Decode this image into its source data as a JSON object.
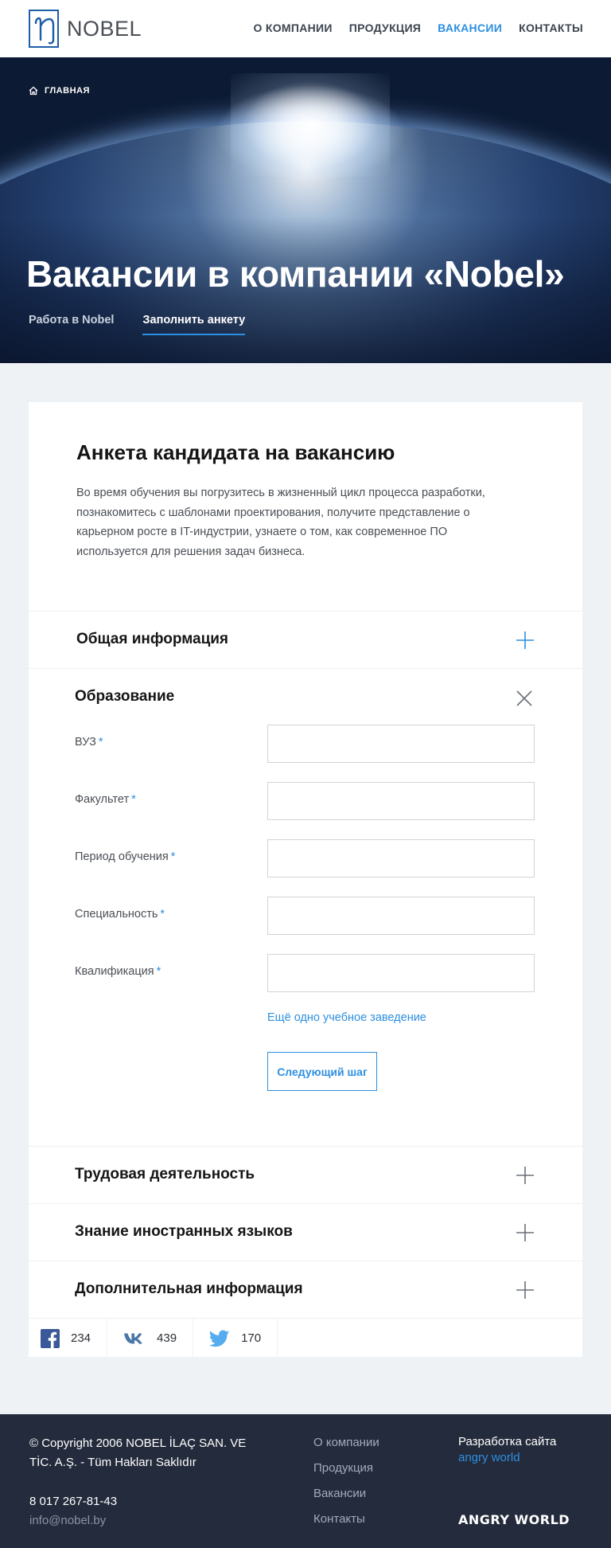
{
  "header": {
    "logo_text": "NOBEL",
    "nav": [
      {
        "label": "О КОМПАНИИ"
      },
      {
        "label": "ПРОДУКЦИЯ"
      },
      {
        "label": "ВАКАНСИИ",
        "active": true
      },
      {
        "label": "КОНТАКТЫ"
      }
    ]
  },
  "hero": {
    "breadcrumb": "ГЛАВНАЯ",
    "title": "Вакансии в компании «Nobel»",
    "tabs": [
      {
        "label": "Работа в Nobel"
      },
      {
        "label": "Заполнить анкету",
        "active": true
      }
    ]
  },
  "form": {
    "title": "Анкета кандидата на вакансию",
    "description": "Во время обучения вы погрузитесь в жизненный цикл процесса разработки, познакомитесь с шаблонами проектирования, получите представление о карьерном росте в IT-индустрии, узнаете о том, как современное ПО используется для решения задач бизнеса.",
    "sections": {
      "general": {
        "title": "Общая информация",
        "icon": "plus-icon"
      },
      "education": {
        "title": "Образование",
        "icon": "close-icon",
        "fields": [
          {
            "label": "ВУЗ",
            "required_mark": "*",
            "value": ""
          },
          {
            "label": "Факультет",
            "required_mark": "*",
            "value": ""
          },
          {
            "label": "Период обучения",
            "required_mark": "*",
            "value": ""
          },
          {
            "label": "Специальность",
            "required_mark": "*",
            "value": ""
          },
          {
            "label": "Квалификация",
            "required_mark": "*",
            "value": ""
          }
        ],
        "add_link": "Ещё одно учебное заведение",
        "next_button": "Следующий шаг"
      },
      "work": {
        "title": "Трудовая деятельность",
        "icon": "plus-icon"
      },
      "languages": {
        "title": "Знание иностранных языков",
        "icon": "plus-icon"
      },
      "additional": {
        "title": "Дополнительная информация",
        "icon": "plus-icon"
      }
    }
  },
  "share": [
    {
      "network": "facebook-icon",
      "count": "234",
      "color": "#3b5998"
    },
    {
      "network": "vk-icon",
      "count": "439",
      "color": "#4a76a8"
    },
    {
      "network": "twitter-icon",
      "count": "170",
      "color": "#55acee"
    }
  ],
  "footer": {
    "copyright": "© Copyright 2006 NOBEL İLAÇ SAN. VE TİC. A.Ş. - Tüm Hakları Saklıdır",
    "phone": "8 017 267-81-43",
    "email": "info@nobel.by",
    "nav": [
      {
        "label": "О компании"
      },
      {
        "label": "Продукция"
      },
      {
        "label": "Вакансии"
      },
      {
        "label": "Контакты"
      }
    ],
    "dev_text": "Разработка сайта",
    "dev_link": "angry world",
    "dev_logo": "ANGRY WORLD"
  },
  "colors": {
    "accent": "#2d8fe0",
    "footer_bg": "#242b3c",
    "page_bg": "#eef2f5",
    "logo_blue": "#1f5da8"
  }
}
